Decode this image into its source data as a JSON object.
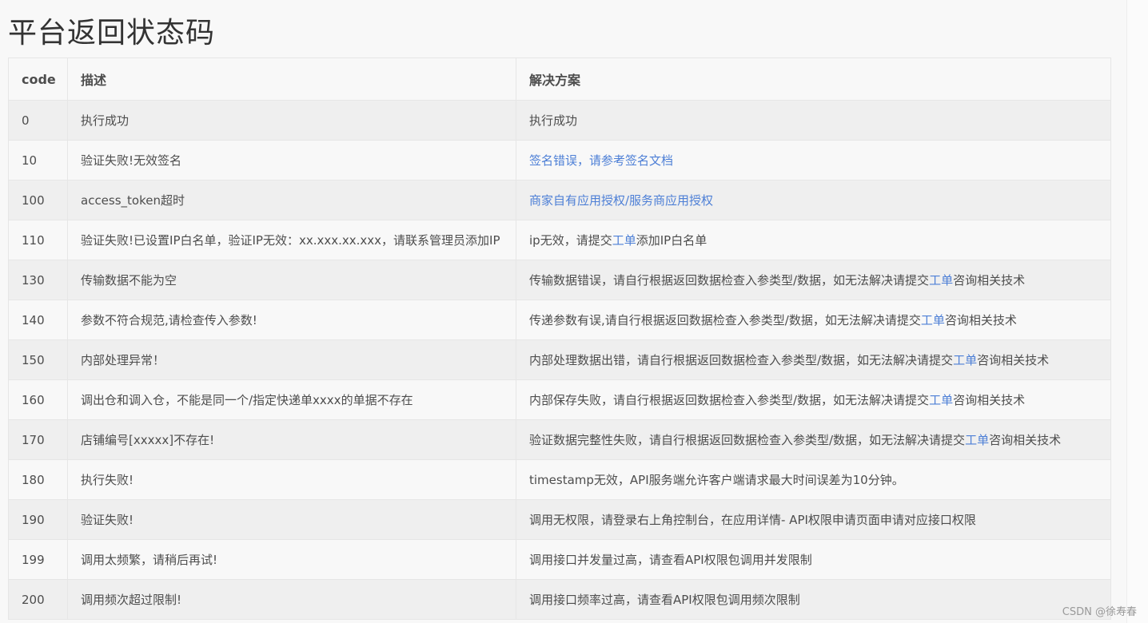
{
  "page_title": "平台返回状态码",
  "table": {
    "headers": [
      "code",
      "描述",
      "解决方案"
    ],
    "rows": [
      {
        "code": "0",
        "desc": "执行成功",
        "solution": [
          {
            "text": "执行成功"
          }
        ]
      },
      {
        "code": "10",
        "desc": "验证失败!无效签名",
        "solution": [
          {
            "text": "签名错误，请参考签名文档",
            "link": true
          }
        ]
      },
      {
        "code": "100",
        "desc": "access_token超时",
        "solution": [
          {
            "text": "商家自有应用授权/服务商应用授权",
            "link": true
          }
        ]
      },
      {
        "code": "110",
        "desc": "验证失败!已设置IP白名单，验证IP无效：xx.xxx.xx.xxx，请联系管理员添加IP",
        "solution": [
          {
            "text": "ip无效，请提交"
          },
          {
            "text": "工单",
            "link": true
          },
          {
            "text": "添加IP白名单"
          }
        ]
      },
      {
        "code": "130",
        "desc": "传输数据不能为空",
        "solution": [
          {
            "text": "传输数据错误，请自行根据返回数据检查入参类型/数据，如无法解决请提交"
          },
          {
            "text": "工单",
            "link": true
          },
          {
            "text": "咨询相关技术"
          }
        ]
      },
      {
        "code": "140",
        "desc": "参数不符合规范,请检查传入参数!",
        "solution": [
          {
            "text": "传递参数有误,请自行根据返回数据检查入参类型/数据，如无法解决请提交"
          },
          {
            "text": "工单",
            "link": true
          },
          {
            "text": "咨询相关技术"
          }
        ]
      },
      {
        "code": "150",
        "desc": "内部处理异常！",
        "solution": [
          {
            "text": "内部处理数据出错，请自行根据返回数据检查入参类型/数据，如无法解决请提交"
          },
          {
            "text": "工单",
            "link": true
          },
          {
            "text": "咨询相关技术"
          }
        ]
      },
      {
        "code": "160",
        "desc": "调出仓和调入仓，不能是同一个/指定快递单xxxx的单据不存在",
        "solution": [
          {
            "text": "内部保存失败，请自行根据返回数据检查入参类型/数据，如无法解决请提交"
          },
          {
            "text": "工单",
            "link": true
          },
          {
            "text": "咨询相关技术"
          }
        ]
      },
      {
        "code": "170",
        "desc": "店铺编号[xxxxx]不存在!",
        "solution": [
          {
            "text": "验证数据完整性失败，请自行根据返回数据检查入参类型/数据，如无法解决请提交"
          },
          {
            "text": "工单",
            "link": true
          },
          {
            "text": "咨询相关技术"
          }
        ]
      },
      {
        "code": "180",
        "desc": "执行失败!",
        "solution": [
          {
            "text": "timestamp无效，API服务端允许客户端请求最大时间误差为10分钟。"
          }
        ]
      },
      {
        "code": "190",
        "desc": "验证失败!",
        "solution": [
          {
            "text": "调用无权限，请登录右上角控制台，在应用详情- API权限申请页面申请对应接口权限"
          }
        ]
      },
      {
        "code": "199",
        "desc": "调用太频繁，请稍后再试!",
        "solution": [
          {
            "text": "调用接口并发量过高，请查看API权限包调用并发限制"
          }
        ]
      },
      {
        "code": "200",
        "desc": "调用频次超过限制!",
        "solution": [
          {
            "text": "调用接口频率过高，请查看API权限包调用频次限制"
          }
        ]
      }
    ]
  },
  "watermark": "CSDN @徐寿春",
  "colors": {
    "link": "#4d7fd6",
    "row_odd": "#efefef",
    "row_even": "#f8f8f8",
    "border": "#e6e6e6"
  }
}
